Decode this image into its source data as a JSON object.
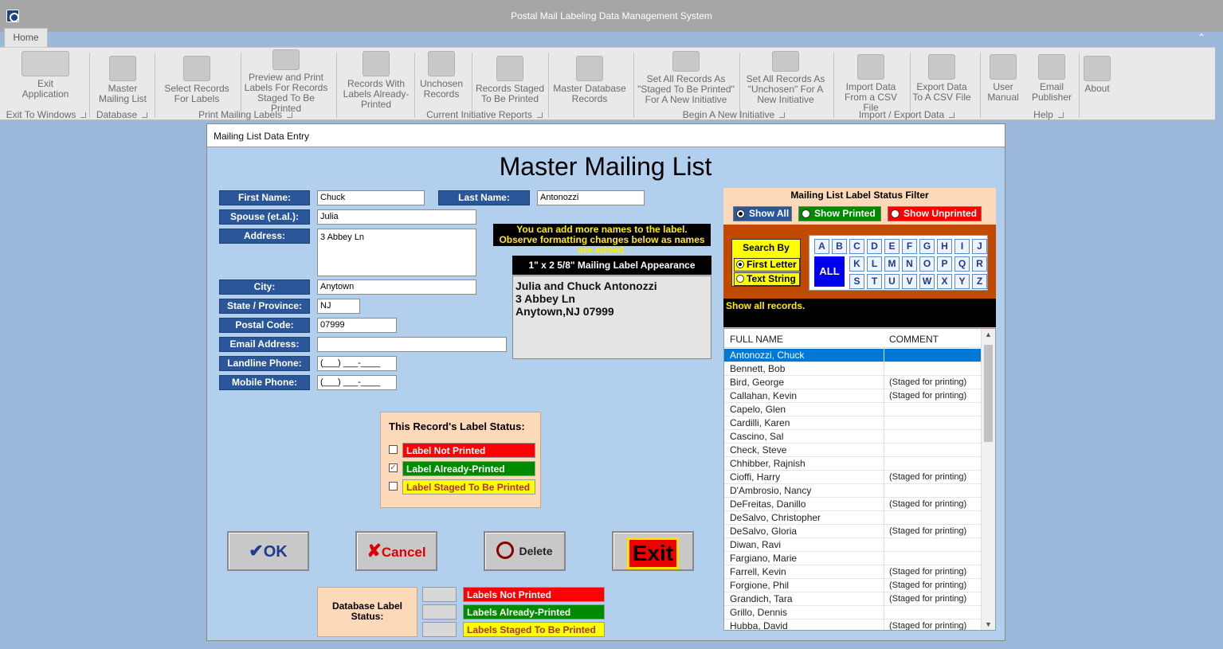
{
  "window": {
    "title": "Postal Mail Labeling Data Management System",
    "tab_home": "Home"
  },
  "ribbon": {
    "buttons": [
      {
        "label": "Exit Application",
        "icon": "checkered-flag-icon"
      },
      {
        "label": "Master Mailing List",
        "icon": "database-list-icon"
      },
      {
        "label": "Select Records For Labels",
        "icon": "checklist-icon"
      },
      {
        "label": "Preview and Print Labels For Records Staged To Be Printed",
        "icon": "printer-icon"
      },
      {
        "label": "Records With Labels Already-Printed",
        "icon": "checkmark-icon"
      },
      {
        "label": "Unchosen Records",
        "icon": "thumbs-down-icon"
      },
      {
        "label": "Records Staged To Be Printed",
        "icon": "lightning-icon"
      },
      {
        "label": "Master Database Records",
        "icon": "database-records-icon"
      },
      {
        "label": "Set All Records As \"Staged To Be Printed\" For A New Initiative",
        "icon": "staged-document-icon"
      },
      {
        "label": "Set All Records As \"Unchosen\" For A New Initiative",
        "icon": "grid-document-icon"
      },
      {
        "label": "Import Data From a CSV File",
        "icon": "import-arrow-icon"
      },
      {
        "label": "Export Data To A CSV File",
        "icon": "csv-export-icon"
      },
      {
        "label": "User Manual",
        "icon": "manual-icon"
      },
      {
        "label": "Email Publisher",
        "icon": "email-icon"
      },
      {
        "label": "About",
        "icon": "shield-question-icon"
      }
    ],
    "groups": [
      "Exit To Windows",
      "Database",
      "Print Mailing Labels",
      "Current Initiative Reports",
      "Begin A New Initiative",
      "Import / Export Data",
      "Help"
    ]
  },
  "dialog": {
    "title": "Mailing List Data Entry",
    "heading": "Master Mailing List",
    "fields": {
      "first_name_label": "First Name:",
      "first_name": "Chuck",
      "last_name_label": "Last Name:",
      "last_name": "Antonozzi",
      "spouse_label": "Spouse (et.al.):",
      "spouse": "Julia",
      "address_label": "Address:",
      "address": "3 Abbey Ln",
      "city_label": "City:",
      "city": "Anytown",
      "state_label": "State / Province:",
      "state": "NJ",
      "postal_label": "Postal Code:",
      "postal": "07999",
      "email_label": "Email Address:",
      "email": "",
      "landline_label": "Landline Phone:",
      "landline": "(___) ___-____",
      "mobile_label": "Mobile Phone:",
      "mobile": "(___) ___-____"
    },
    "hint": "You can add more names to the label. Observe formatting changes below as names are added.",
    "preview": {
      "header": "1\" x 2 5/8\" Mailing Label Appearance",
      "line1": "Julia and Chuck Antonozzi",
      "line2": "3 Abbey Ln",
      "line3": "Anytown,NJ  07999"
    },
    "record_status": {
      "title": "This Record's Label Status:",
      "not_printed": "Label Not Printed",
      "printed": "Label Already-Printed",
      "staged": "Label Staged To Be Printed",
      "checked": "printed"
    },
    "buttons": {
      "ok": "OK",
      "cancel": "Cancel",
      "delete": "Delete",
      "exit": "Exit"
    },
    "db_status": {
      "label": "Database Label Status:",
      "not_printed": "Labels Not Printed",
      "printed": "Labels Already-Printed",
      "staged": "Labels Staged To Be Printed"
    },
    "filter": {
      "title": "Mailing List Label Status Filter",
      "show_all": "Show All",
      "show_printed": "Show Printed",
      "show_unprinted": "Show Unprinted",
      "selected": "show_all"
    },
    "search": {
      "title": "Search By",
      "first_letter": "First Letter",
      "text_string": "Text String",
      "selected": "first_letter",
      "all": "ALL",
      "letters": [
        "A",
        "B",
        "C",
        "D",
        "E",
        "F",
        "G",
        "H",
        "I",
        "J",
        "K",
        "L",
        "M",
        "N",
        "O",
        "P",
        "Q",
        "R",
        "S",
        "T",
        "U",
        "V",
        "W",
        "X",
        "Y",
        "Z"
      ]
    },
    "search_status": "Show all records.",
    "list": {
      "col_name": "FULL NAME",
      "col_comment": "COMMENT",
      "rows": [
        {
          "name": "Antonozzi, Chuck",
          "comment": ""
        },
        {
          "name": "Bennett, Bob",
          "comment": ""
        },
        {
          "name": "Bird, George",
          "comment": "(Staged for printing)"
        },
        {
          "name": "Callahan, Kevin",
          "comment": "(Staged for printing)"
        },
        {
          "name": "Capelo, Glen",
          "comment": ""
        },
        {
          "name": "Cardilli, Karen",
          "comment": ""
        },
        {
          "name": "Cascino, Sal",
          "comment": ""
        },
        {
          "name": "Check, Steve",
          "comment": ""
        },
        {
          "name": "Chhibber, Rajnish",
          "comment": ""
        },
        {
          "name": "Cioffi, Harry",
          "comment": "(Staged for printing)"
        },
        {
          "name": "D'Ambrosio, Nancy",
          "comment": ""
        },
        {
          "name": "DeFreitas, Danillo",
          "comment": "(Staged for printing)"
        },
        {
          "name": "DeSalvo, Christopher",
          "comment": ""
        },
        {
          "name": "DeSalvo, Gloria",
          "comment": "(Staged for printing)"
        },
        {
          "name": "Diwan, Ravi",
          "comment": ""
        },
        {
          "name": "Fargiano, Marie",
          "comment": ""
        },
        {
          "name": "Farrell, Kevin",
          "comment": "(Staged for printing)"
        },
        {
          "name": "Forgione, Phil",
          "comment": "(Staged for printing)"
        },
        {
          "name": "Grandich, Tara",
          "comment": "(Staged for printing)"
        },
        {
          "name": "Grillo, Dennis",
          "comment": ""
        },
        {
          "name": "Hubba, David",
          "comment": "(Staged for printing)"
        }
      ]
    }
  }
}
